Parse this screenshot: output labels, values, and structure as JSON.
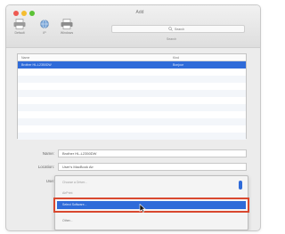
{
  "window": {
    "title": "Add"
  },
  "toolbar": {
    "default_label": "Default",
    "ip_label": "IP",
    "windows_label": "Windows"
  },
  "search": {
    "placeholder": "Search",
    "label": "Search"
  },
  "printer_list": {
    "headers": {
      "name": "Name",
      "kind": "Kind"
    },
    "rows": [
      {
        "name": "Brother HL-L2350DW",
        "kind": "Bonjour"
      },
      {
        "name": "",
        "kind": ""
      },
      {
        "name": "",
        "kind": ""
      },
      {
        "name": "",
        "kind": ""
      },
      {
        "name": "",
        "kind": ""
      },
      {
        "name": "",
        "kind": ""
      },
      {
        "name": "",
        "kind": ""
      },
      {
        "name": "",
        "kind": ""
      },
      {
        "name": "",
        "kind": ""
      },
      {
        "name": "",
        "kind": ""
      },
      {
        "name": "",
        "kind": ""
      }
    ]
  },
  "form": {
    "name_label": "Name:",
    "name_value": "Brother HL-L2350DW",
    "location_label": "Location:",
    "location_value": "User's MacBook Air",
    "use_label": "Use:"
  },
  "use_menu": {
    "items": [
      "Choose a Driver...",
      "AirPrint",
      "Select Software...",
      "Other..."
    ],
    "selected": "Select Software..."
  },
  "colors": {
    "selection": "#2f6bd9",
    "highlight_outline": "#d9482f",
    "traffic_close": "#ee5a52",
    "traffic_min": "#f5bd2f",
    "traffic_max": "#5bc236"
  }
}
